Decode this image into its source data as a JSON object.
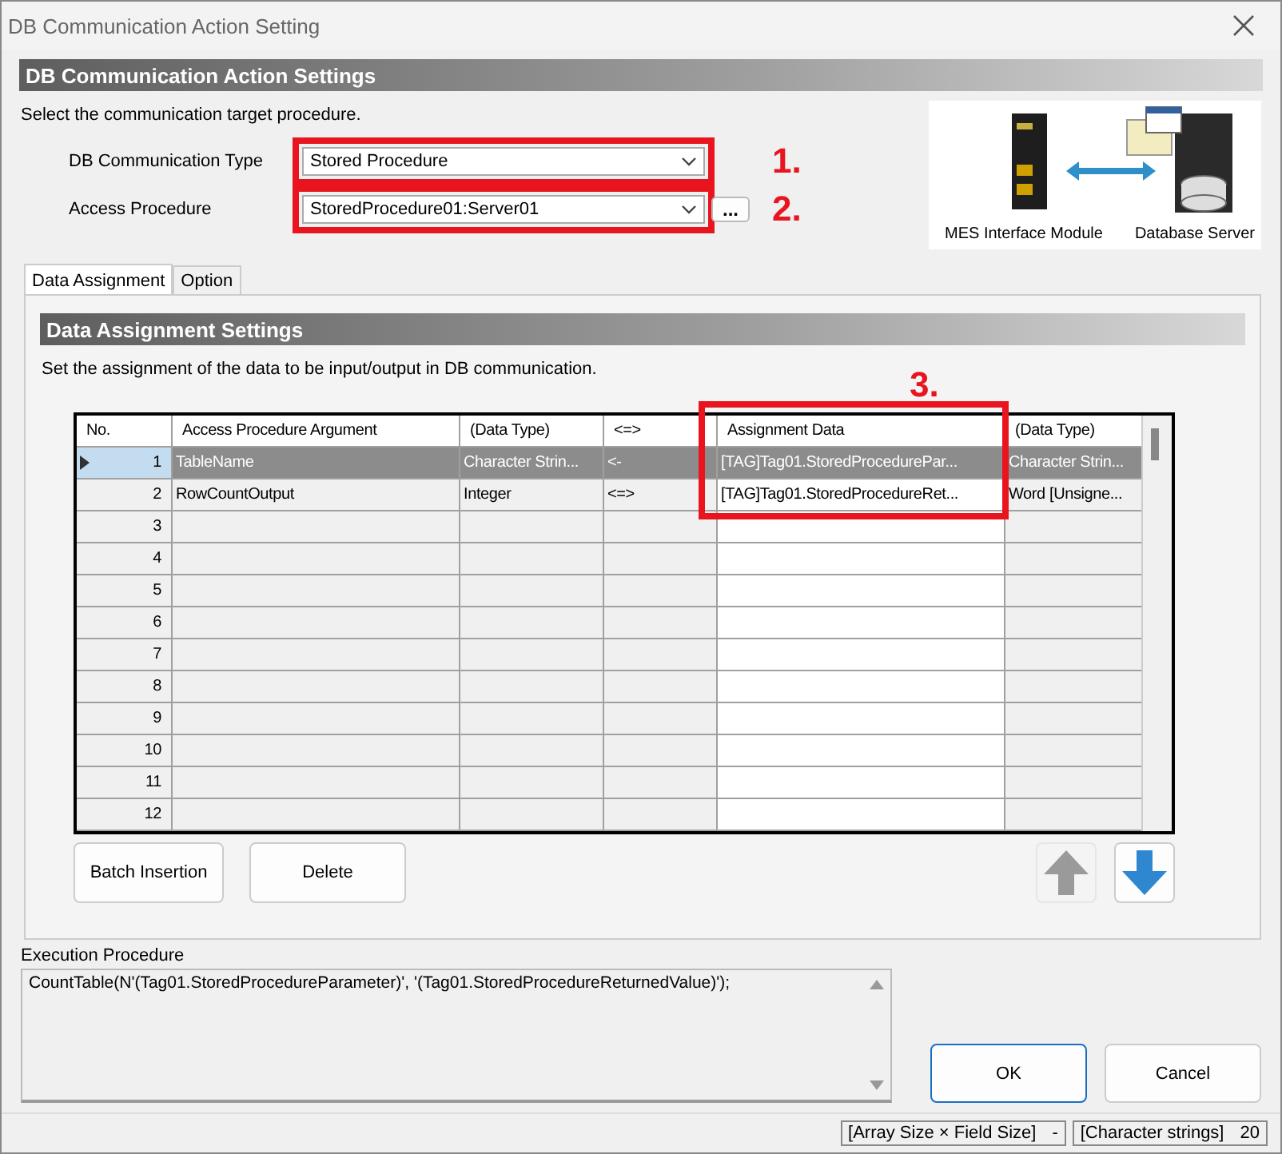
{
  "window": {
    "title": "DB Communication Action Setting"
  },
  "section": {
    "title": "DB Communication Action Settings",
    "instruction": "Select the communication target procedure."
  },
  "fields": [
    {
      "label": "DB Communication Type",
      "value": "Stored Procedure",
      "callout": "1."
    },
    {
      "label": "Access Procedure",
      "value": "StoredProcedure01:Server01",
      "browse": "...",
      "callout": "2."
    }
  ],
  "diagram": {
    "module_label": "MES Interface Module",
    "server_label": "Database Server"
  },
  "tabs": [
    {
      "label": "Data Assignment",
      "selected": true
    },
    {
      "label": "Option",
      "selected": false
    }
  ],
  "assignment": {
    "title": "Data Assignment Settings",
    "instruction": "Set the assignment of the data to be input/output in DB communication.",
    "callout": "3.",
    "columns": [
      "No.",
      "Access Procedure Argument",
      "(Data Type)",
      "<=>",
      "Assignment Data",
      "(Data Type)"
    ],
    "rows": [
      {
        "selected": true,
        "cells": [
          "1",
          "TableName",
          "Character Strin...",
          "<-",
          "[TAG]Tag01.StoredProcedurePar...",
          "Character Strin..."
        ]
      },
      {
        "selected": false,
        "cells": [
          "2",
          "RowCountOutput",
          "Integer",
          "<=>",
          "[TAG]Tag01.StoredProcedureRet...",
          "Word [Unsigne..."
        ]
      },
      {
        "selected": false,
        "cells": [
          "3",
          "",
          "",
          "",
          "",
          ""
        ]
      },
      {
        "selected": false,
        "cells": [
          "4",
          "",
          "",
          "",
          "",
          ""
        ]
      },
      {
        "selected": false,
        "cells": [
          "5",
          "",
          "",
          "",
          "",
          ""
        ]
      },
      {
        "selected": false,
        "cells": [
          "6",
          "",
          "",
          "",
          "",
          ""
        ]
      },
      {
        "selected": false,
        "cells": [
          "7",
          "",
          "",
          "",
          "",
          ""
        ]
      },
      {
        "selected": false,
        "cells": [
          "8",
          "",
          "",
          "",
          "",
          ""
        ]
      },
      {
        "selected": false,
        "cells": [
          "9",
          "",
          "",
          "",
          "",
          ""
        ]
      },
      {
        "selected": false,
        "cells": [
          "10",
          "",
          "",
          "",
          "",
          ""
        ]
      },
      {
        "selected": false,
        "cells": [
          "11",
          "",
          "",
          "",
          "",
          ""
        ]
      },
      {
        "selected": false,
        "cells": [
          "12",
          "",
          "",
          "",
          "",
          ""
        ]
      }
    ],
    "buttons": [
      "Batch Insertion",
      "Delete"
    ],
    "move_buttons": [
      {
        "kind": "up",
        "disabled": true
      },
      {
        "kind": "down",
        "disabled": false
      }
    ]
  },
  "execution": {
    "label": "Execution Procedure",
    "value": "CountTable(N'(Tag01.StoredProcedureParameter)', '(Tag01.StoredProcedureReturnedValue)');"
  },
  "dialog_buttons": [
    {
      "label": "OK",
      "default": true
    },
    {
      "label": "Cancel",
      "default": false
    }
  ],
  "status_bar": [
    {
      "label": "[Array Size × Field Size]",
      "value": "-"
    },
    {
      "label": "[Character strings]",
      "value": "20"
    }
  ]
}
